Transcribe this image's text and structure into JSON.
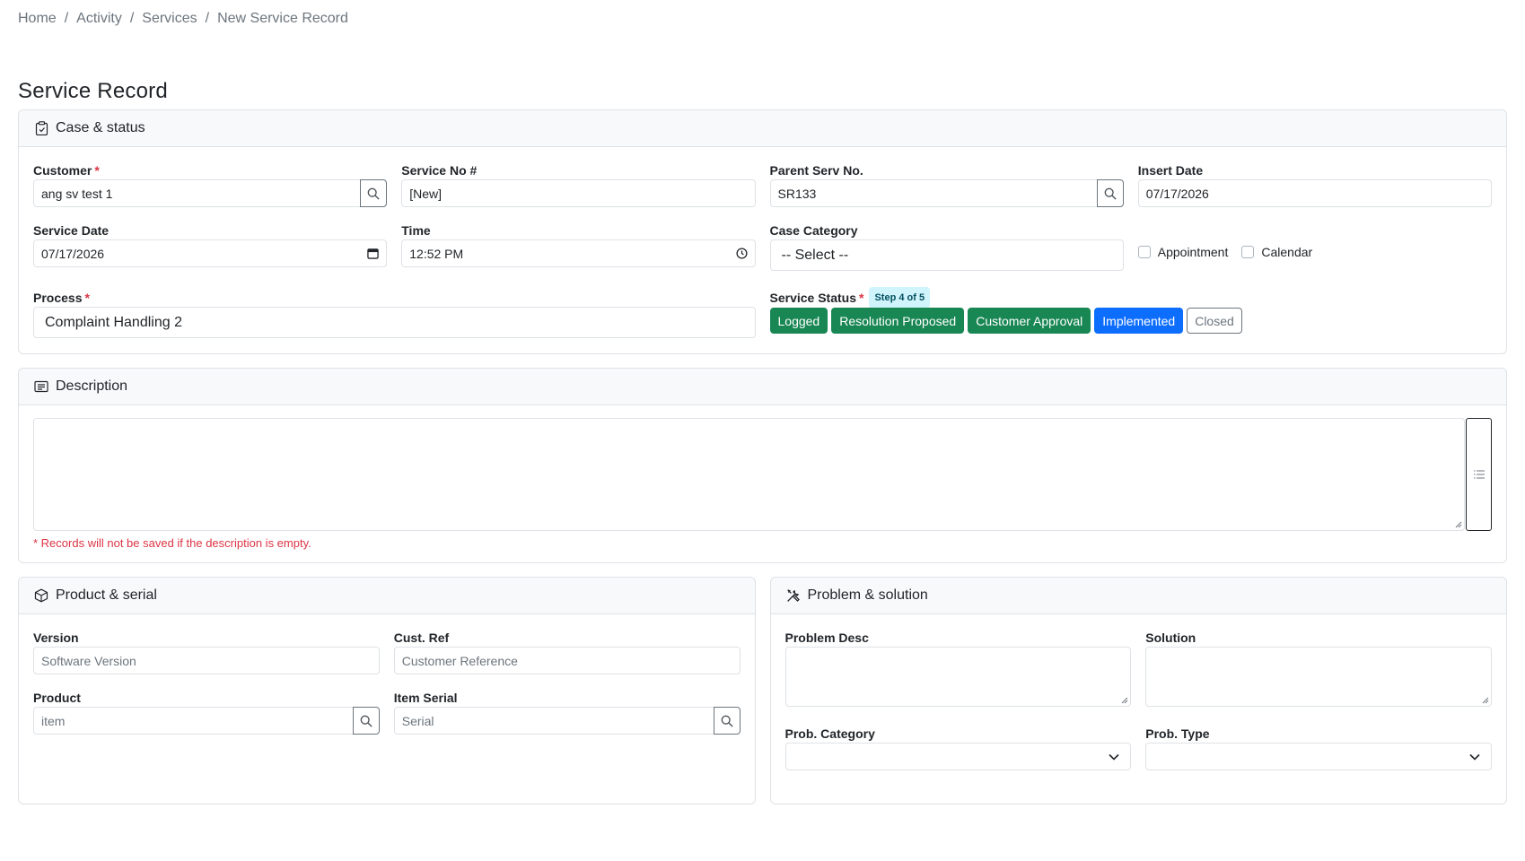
{
  "breadcrumb": {
    "items": [
      "Home",
      "Activity",
      "Services"
    ],
    "current": "New Service Record",
    "separator": "/"
  },
  "page_title": "Service Record",
  "case_status": {
    "title": "Case & status",
    "customer": {
      "label": "Customer",
      "required": "*",
      "value": "ang sv test 1"
    },
    "service_no": {
      "label": "Service No #",
      "value": "[New]"
    },
    "parent_serv": {
      "label": "Parent Serv No.",
      "value": "SR133"
    },
    "insert_date": {
      "label": "Insert Date",
      "value": "07/17/2026"
    },
    "service_date": {
      "label": "Service Date",
      "value": "07/17/2026"
    },
    "time": {
      "label": "Time",
      "value": "12:52 PM"
    },
    "case_category": {
      "label": "Case Category",
      "value": "-- Select --"
    },
    "appointment": {
      "label": "Appointment"
    },
    "calendar": {
      "label": "Calendar"
    },
    "process": {
      "label": "Process",
      "required": "*",
      "value": "Complaint Handling 2"
    },
    "service_status": {
      "label": "Service Status",
      "required": "*",
      "step_badge": "Step 4 of 5",
      "steps": [
        {
          "label": "Logged",
          "state": "done"
        },
        {
          "label": "Resolution Proposed",
          "state": "done"
        },
        {
          "label": "Customer Approval",
          "state": "done"
        },
        {
          "label": "Implemented",
          "state": "current"
        },
        {
          "label": "Closed",
          "state": "todo"
        }
      ]
    }
  },
  "description": {
    "title": "Description",
    "helper": "* Records will not be saved if the description is empty."
  },
  "product_serial": {
    "title": "Product & serial",
    "version": {
      "label": "Version",
      "placeholder": "Software Version"
    },
    "cust_ref": {
      "label": "Cust. Ref",
      "placeholder": "Customer Reference"
    },
    "product": {
      "label": "Product",
      "placeholder": "item"
    },
    "item_serial": {
      "label": "Item Serial",
      "placeholder": "Serial"
    }
  },
  "problem_solution": {
    "title": "Problem & solution",
    "problem_desc": {
      "label": "Problem Desc"
    },
    "solution": {
      "label": "Solution"
    },
    "prob_category": {
      "label": "Prob. Category",
      "value": ""
    },
    "prob_type": {
      "label": "Prob. Type",
      "value": ""
    }
  },
  "colors": {
    "success": "#198754",
    "primary": "#0d6efd",
    "danger": "#dc3545",
    "info_bg": "#cff4fc",
    "border": "#dee2e6"
  },
  "icons": {
    "case": "clipboard-icon",
    "description": "card-text-icon",
    "product": "box-icon",
    "problem": "tools-icon",
    "search": "search-icon",
    "calendar": "calendar-icon",
    "clock": "clock-icon",
    "chevron": "chevron-down-icon",
    "list": "list-icon"
  }
}
